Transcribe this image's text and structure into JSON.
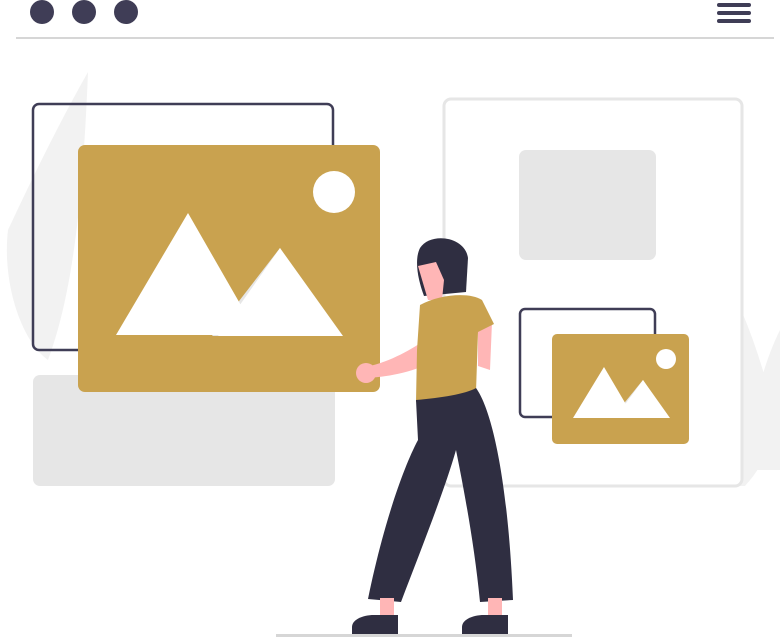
{
  "illustration": {
    "subject": "image-gallery-browsing",
    "window_controls": [
      "dot",
      "dot",
      "dot"
    ],
    "menu_icon": "hamburger-menu-icon",
    "colors": {
      "accent": "#c9a24f",
      "dark": "#2f2e41",
      "skin": "#ffb6b6",
      "light_gray": "#e6e6e6",
      "pale_gray": "#f2f2f2",
      "white": "#ffffff"
    },
    "icons": [
      "image-placeholder-icon",
      "sun-icon",
      "mountain-icon"
    ]
  }
}
